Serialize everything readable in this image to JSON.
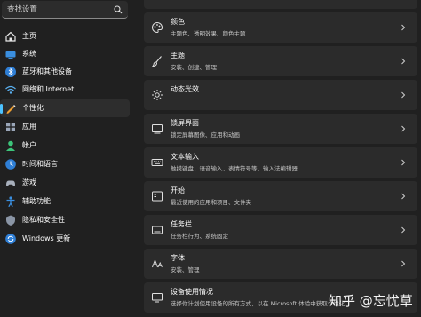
{
  "search": {
    "placeholder": "查找设置"
  },
  "sidebar": {
    "items": [
      {
        "label": "主页",
        "icon": "home-icon"
      },
      {
        "label": "系统",
        "icon": "system-icon"
      },
      {
        "label": "蓝牙和其他设备",
        "icon": "bluetooth-icon"
      },
      {
        "label": "网络和 Internet",
        "icon": "wifi-icon"
      },
      {
        "label": "个性化",
        "icon": "pen-icon",
        "active": true
      },
      {
        "label": "应用",
        "icon": "apps-icon"
      },
      {
        "label": "帐户",
        "icon": "account-icon"
      },
      {
        "label": "时间和语言",
        "icon": "time-language-icon"
      },
      {
        "label": "游戏",
        "icon": "gaming-icon"
      },
      {
        "label": "辅助功能",
        "icon": "accessibility-icon"
      },
      {
        "label": "隐私和安全性",
        "icon": "shield-icon"
      },
      {
        "label": "Windows 更新",
        "icon": "windows-update-icon"
      }
    ]
  },
  "main": {
    "cards": [
      {
        "title": "颜色",
        "subtitle": "主题色、透明效果、颜色主题",
        "icon": "palette-icon"
      },
      {
        "title": "主题",
        "subtitle": "安装、创建、管理",
        "icon": "brush-icon"
      },
      {
        "title": "动态光效",
        "subtitle": "",
        "icon": "lighting-icon"
      },
      {
        "title": "锁屏界面",
        "subtitle": "锁定屏幕图像、应用和动画",
        "icon": "lock-screen-icon"
      },
      {
        "title": "文本输入",
        "subtitle": "触摸键盘、语音输入、表情符号等、输入法编辑器",
        "icon": "keyboard-icon"
      },
      {
        "title": "开始",
        "subtitle": "最近使用的应用和项目、文件夹",
        "icon": "start-icon"
      },
      {
        "title": "任务栏",
        "subtitle": "任务栏行为、系统固定",
        "icon": "taskbar-icon"
      },
      {
        "title": "字体",
        "subtitle": "安装、管理",
        "icon": "font-icon"
      },
      {
        "title": "设备使用情况",
        "subtitle": "选择你计划使用设备的所有方式，以在 Microsoft 体验中获取个性化",
        "icon": "device-usage-icon"
      }
    ]
  },
  "watermark": {
    "text": "知乎 @忘忧草"
  },
  "colors": {
    "accent": "#4cc2ff",
    "background": "#202020",
    "card": "#2b2b2b"
  }
}
